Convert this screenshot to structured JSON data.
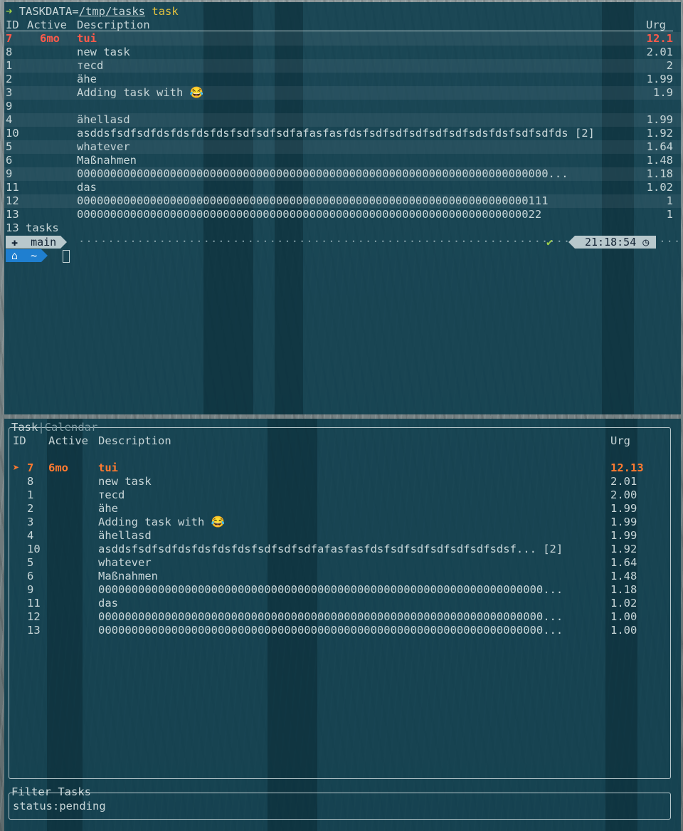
{
  "terminal": {
    "prompt_arrow": "➜",
    "command_prefix": "TASKDATA=",
    "command_path": "/tmp/tasks",
    "command_word": "task",
    "headers": {
      "id": "ID",
      "active": "Active",
      "description": "Description",
      "urgency": "Urg"
    },
    "rows": [
      {
        "id": "7",
        "active": "6mo",
        "description": "tui",
        "urg": "12.1"
      },
      {
        "id": "8",
        "active": "",
        "description": "new task",
        "urg": "2.01"
      },
      {
        "id": "1",
        "active": "",
        "description": "тecd",
        "urg": "2"
      },
      {
        "id": "2",
        "active": "",
        "description": "ähe",
        "urg": "1.99"
      },
      {
        "id": "3",
        "active": "",
        "description": "Adding task with 😂",
        "urg": "1.9"
      },
      {
        "id": "9",
        "active": "",
        "description": "",
        "urg": ""
      },
      {
        "id": "4",
        "active": "",
        "description": "ähellasd",
        "urg": "1.99"
      },
      {
        "id": "10",
        "active": "",
        "description": "asddsfsdfsdfdsfdsfdsfdsfsdfsdfsdfafasfasfdsfsdfsdfsdfsdfsdfsdsfdsfsdfsdfds [2]",
        "urg": "1.92"
      },
      {
        "id": "5",
        "active": "",
        "description": "whatever",
        "urg": "1.64"
      },
      {
        "id": "6",
        "active": "",
        "description": "Maßnahmen",
        "urg": "1.48"
      },
      {
        "id": "9",
        "active": "",
        "description": "00000000000000000000000000000000000000000000000000000000000000000000000...",
        "urg": "1.18"
      },
      {
        "id": "11",
        "active": "",
        "description": "das",
        "urg": "1.02"
      },
      {
        "id": "12",
        "active": "",
        "description": "00000000000000000000000000000000000000000000000000000000000000000000111",
        "urg": "1"
      },
      {
        "id": "13",
        "active": "",
        "description": "0000000000000000000000000000000000000000000000000000000000000000000022",
        "urg": "1"
      }
    ],
    "footer": "13 tasks",
    "prompt": {
      "branch_icon": "✚",
      "branch": "main",
      "check": "✔",
      "time": "21:18:54",
      "clock_icon": "◷",
      "home_icon": "⌂",
      "cwd": "~"
    }
  },
  "tui": {
    "tabs": {
      "active": "Task",
      "separator": "|",
      "inactive": "Calendar"
    },
    "headers": {
      "id": "ID",
      "active": "Active",
      "description": "Description",
      "urgency": "Urg"
    },
    "selected_marker": "➤",
    "rows": [
      {
        "id": "7",
        "active": "6mo",
        "description": "tui",
        "urg": "12.13"
      },
      {
        "id": "8",
        "active": "",
        "description": "new task",
        "urg": "2.01"
      },
      {
        "id": "1",
        "active": "",
        "description": "тecd",
        "urg": "2.00"
      },
      {
        "id": "2",
        "active": "",
        "description": "ähe",
        "urg": "1.99"
      },
      {
        "id": "3",
        "active": "",
        "description": "Adding task with 😂",
        "urg": "1.99"
      },
      {
        "id": "4",
        "active": "",
        "description": "ähellasd",
        "urg": "1.99"
      },
      {
        "id": "10",
        "active": "",
        "description": "asddsfsdfsdfdsfdsfdsfdsfsdfsdfsdfafasfasfdsfsdfsdfsdfsdfsdfsdsf... [2]",
        "urg": "1.92"
      },
      {
        "id": "5",
        "active": "",
        "description": "whatever",
        "urg": "1.64"
      },
      {
        "id": "6",
        "active": "",
        "description": "Maßnahmen",
        "urg": "1.48"
      },
      {
        "id": "9",
        "active": "",
        "description": "0000000000000000000000000000000000000000000000000000000000000000000...",
        "urg": "1.18"
      },
      {
        "id": "11",
        "active": "",
        "description": "das",
        "urg": "1.02"
      },
      {
        "id": "12",
        "active": "",
        "description": "0000000000000000000000000000000000000000000000000000000000000000000...",
        "urg": "1.00"
      },
      {
        "id": "13",
        "active": "",
        "description": "0000000000000000000000000000000000000000000000000000000000000000000...",
        "urg": "1.00"
      }
    ],
    "filter": {
      "title": "Filter Tasks",
      "value": "status:pending"
    }
  },
  "colors": {
    "pane_bg": "#0e3e4e",
    "text": "#c8d6d8",
    "urgent_red": "#ff5a4a",
    "selected_orange": "#ff7a30",
    "prompt_green": "#9ed048",
    "command_yellow": "#e0c040",
    "home_blue": "#1f7fd0"
  }
}
